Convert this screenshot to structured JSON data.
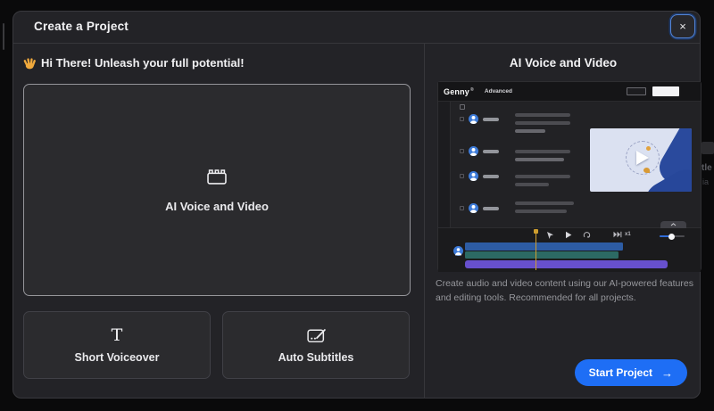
{
  "modal": {
    "title": "Create a Project",
    "close_glyph": "×"
  },
  "left": {
    "greeting_emoji": "👋",
    "greeting": "Hi There! Unleash your full potential!",
    "main_card": {
      "label": "AI Voice and Video"
    },
    "cards": [
      {
        "icon_glyph": "T",
        "label": "Short Voiceover"
      },
      {
        "label": "Auto Subtitles"
      }
    ]
  },
  "right": {
    "title": "AI Voice and Video",
    "preview": {
      "app_name": "Genny",
      "logo_mark": "®",
      "mode": "Advanced",
      "speed": "x1"
    },
    "description": "Create audio and video content using our AI-powered features and editing tools. Recommended for all projects.",
    "start_button": {
      "label": "Start Project",
      "arrow": "→"
    }
  },
  "background": {
    "fragments": [
      "tle",
      "ia"
    ]
  },
  "colors": {
    "accent_blue": "#1e6ef5",
    "close_ring": "#5585d6",
    "modal_bg": "#232327",
    "card_border_light": "#95959a",
    "track_blue": "#2d5ca4",
    "track_teal": "#2c6a64",
    "track_purple": "#6750cd",
    "playhead_yellow": "#cf9e2e",
    "thumbnail_bg": "#dbe1f1",
    "hand_blue": "#2a4a9d",
    "avatar_blue": "#3d7bd9"
  }
}
